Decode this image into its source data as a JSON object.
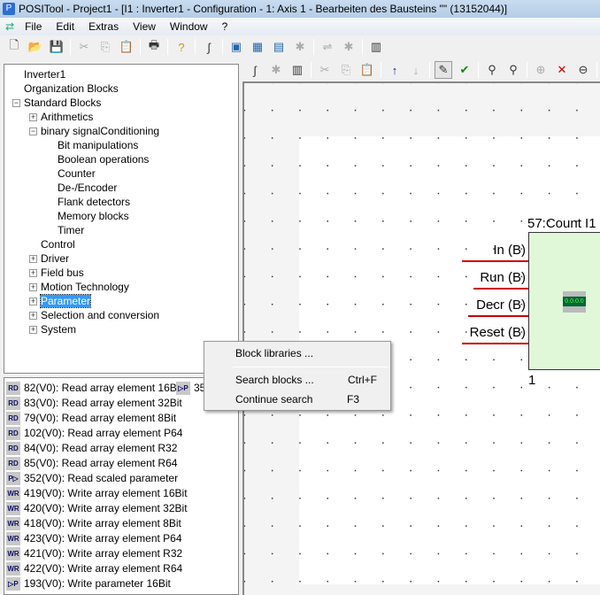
{
  "title": "POSITool - Project1 - [I1 : Inverter1 - Configuration - 1: Axis 1 - Bearbeiten des Bausteins \"\" (13152044)]",
  "menu": [
    "File",
    "Edit",
    "Extras",
    "View",
    "Window",
    "?"
  ],
  "tree": [
    {
      "label": "Inverter1",
      "level": 0,
      "exp": ""
    },
    {
      "label": "Organization Blocks",
      "level": 0,
      "exp": ""
    },
    {
      "label": "Standard Blocks",
      "level": 0,
      "exp": "-"
    },
    {
      "label": "Arithmetics",
      "level": 1,
      "exp": "+"
    },
    {
      "label": "binary signalConditioning",
      "level": 1,
      "exp": "-"
    },
    {
      "label": "Bit manipulations",
      "level": 2,
      "exp": ""
    },
    {
      "label": "Boolean operations",
      "level": 2,
      "exp": ""
    },
    {
      "label": "Counter",
      "level": 2,
      "exp": ""
    },
    {
      "label": "De-/Encoder",
      "level": 2,
      "exp": ""
    },
    {
      "label": "Flank detectors",
      "level": 2,
      "exp": ""
    },
    {
      "label": "Memory blocks",
      "level": 2,
      "exp": ""
    },
    {
      "label": "Timer",
      "level": 2,
      "exp": ""
    },
    {
      "label": "Control",
      "level": 1,
      "exp": ""
    },
    {
      "label": "Driver",
      "level": 1,
      "exp": "+"
    },
    {
      "label": "Field bus",
      "level": 1,
      "exp": "+"
    },
    {
      "label": "Motion Technology",
      "level": 1,
      "exp": "+"
    },
    {
      "label": "Parameter",
      "level": 1,
      "exp": "+",
      "selected": true
    },
    {
      "label": "Selection and conversion",
      "level": 1,
      "exp": "+"
    },
    {
      "label": "System",
      "level": 1,
      "exp": "+"
    }
  ],
  "blocks": [
    {
      "icon": "RD",
      "label": "82(V0): Read array element 16Bit"
    },
    {
      "icon": "RD",
      "label": "83(V0): Read array element 32Bit"
    },
    {
      "icon": "RD",
      "label": "79(V0): Read array element 8Bit"
    },
    {
      "icon": "RD",
      "label": "102(V0): Read array element P64"
    },
    {
      "icon": "RD",
      "label": "84(V0): Read array element R32"
    },
    {
      "icon": "RD",
      "label": "85(V0): Read array element R64"
    },
    {
      "icon": "P▷",
      "label": "352(V0): Read scaled parameter"
    },
    {
      "icon": "WR",
      "label": "419(V0): Write array element 16Bit"
    },
    {
      "icon": "WR",
      "label": "420(V0): Write array element 32Bit"
    },
    {
      "icon": "WR",
      "label": "418(V0): Write array element 8Bit"
    },
    {
      "icon": "WR",
      "label": "423(V0): Write array element P64"
    },
    {
      "icon": "WR",
      "label": "421(V0): Write array element R32"
    },
    {
      "icon": "WR",
      "label": "422(V0): Write array element R64"
    },
    {
      "icon": "▷P",
      "label": "193(V0): Write parameter 16Bit"
    }
  ],
  "blocks_col2": [
    {
      "icon": "▷P",
      "label": "35"
    }
  ],
  "block": {
    "title": "57:Count I1",
    "inputs": [
      "In (B)",
      "Run (B)",
      "Decr (B)",
      "Reset (B)"
    ],
    "number": "1",
    "display": "0.0.0.0"
  },
  "context_menu": [
    {
      "label": "Block libraries ...",
      "shortcut": ""
    },
    {
      "label": "Search blocks  ...",
      "shortcut": "Ctrl+F"
    },
    {
      "label": "Continue search",
      "shortcut": "F3"
    }
  ],
  "colors": {
    "selection": "#3399ff",
    "block_fill": "#e0f8d8",
    "wire": "#cc0000"
  }
}
